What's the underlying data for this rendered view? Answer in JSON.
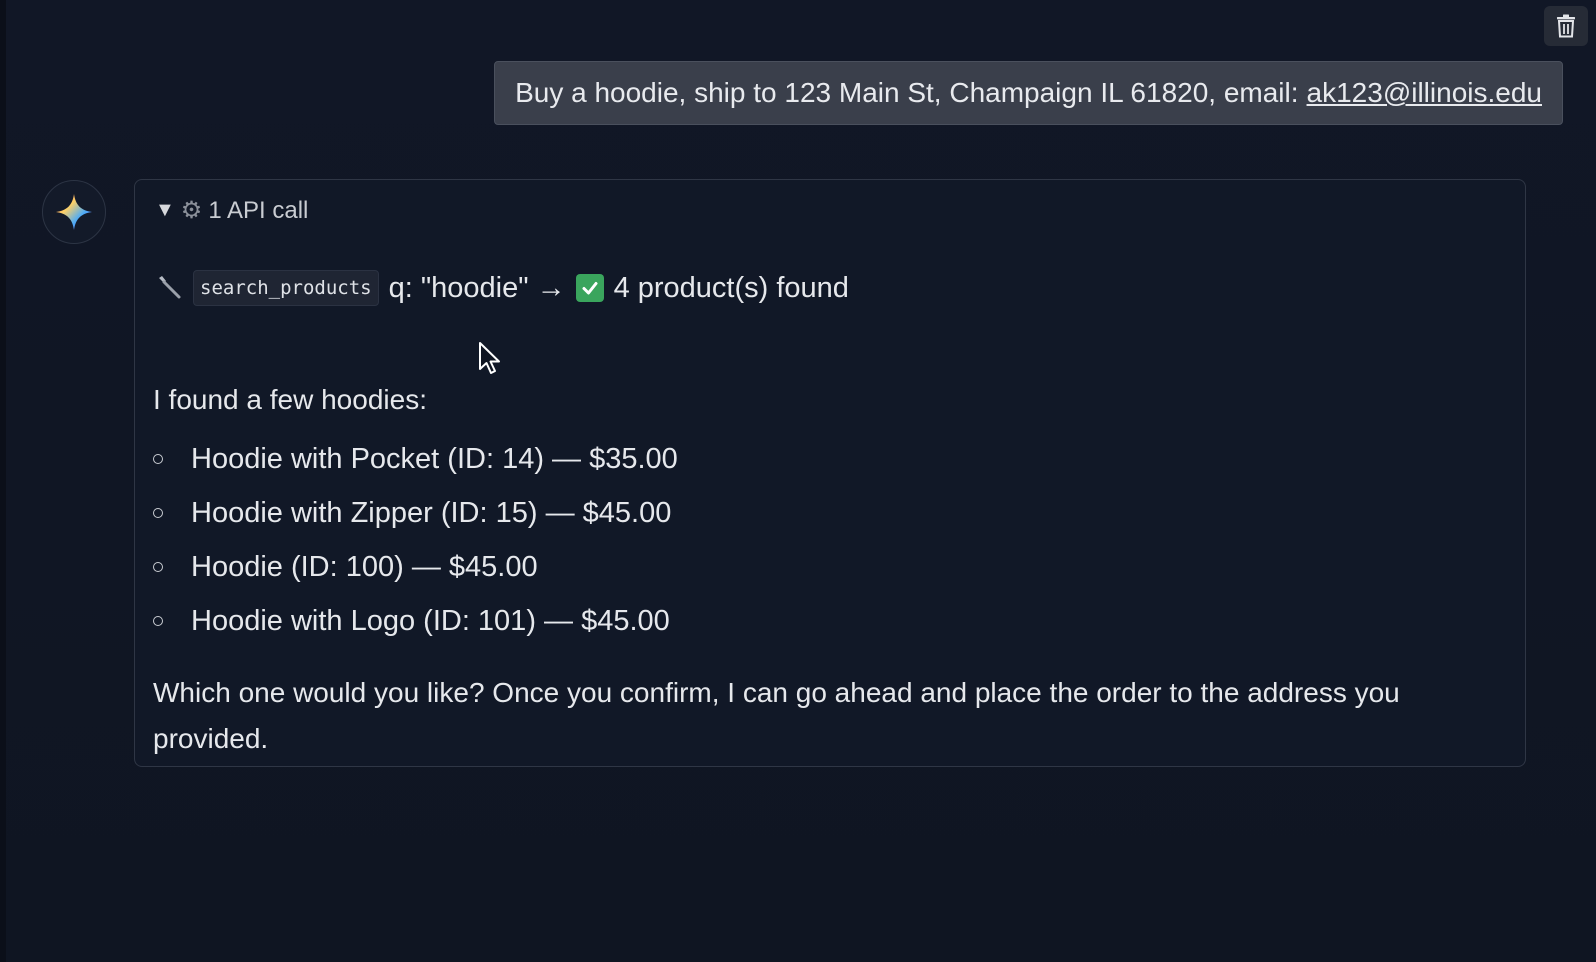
{
  "toolbar": {
    "trash_icon": "trash-icon"
  },
  "user_message": {
    "text": "Buy a hoodie, ship to 123 Main St, Champaign IL 61820, email:",
    "email": "ak123@illinois.edu"
  },
  "assistant": {
    "avatar_icon": "sparkle-icon",
    "api_summary": {
      "toggle_glyph": "▼",
      "gear_glyph": "⚙",
      "label": "1 API call"
    },
    "tool_call": {
      "tool_name": "search_products",
      "query": "q: \"hoodie\" →",
      "result": "4 product(s) found"
    },
    "intro": "I found a few hoodies:",
    "products": [
      "Hoodie with Pocket (ID: 14) — $35.00",
      "Hoodie with Zipper (ID: 15) — $45.00",
      "Hoodie (ID: 100) — $45.00",
      "Hoodie with Logo (ID: 101) — $45.00"
    ],
    "closing": "Which one would you like? Once you confirm, I can go ahead and place the order to the address you provided."
  },
  "colors": {
    "background": "#111726",
    "user_bubble": "#3a3f4b",
    "card_border": "#2f3645",
    "check_green": "#3aa55d"
  }
}
